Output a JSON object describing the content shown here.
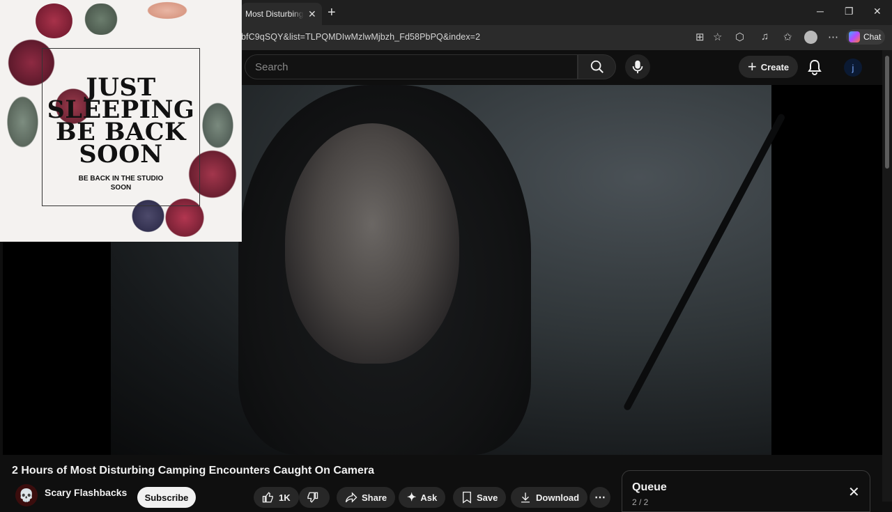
{
  "browser": {
    "tab_title": "Most Disturbing C",
    "url": "bfC9qSQY&list=TLPQMDIwMzlwMjbzh_Fd58PbPQ&index=2",
    "chat_label": "Chat"
  },
  "header": {
    "search_placeholder": "Search",
    "create_label": "Create",
    "avatar_letter": "j"
  },
  "pip": {
    "headline_lines": [
      "JUST",
      "SLEEPING",
      "BE BACK",
      "SOON"
    ],
    "subtext_lines": [
      "BE BACK IN THE STUDIO",
      "SOON"
    ]
  },
  "video": {
    "title": "2 Hours of Most Disturbing Camping Encounters Caught On Camera",
    "channel_name": "Scary Flashbacks",
    "subscribe_label": "Subscribe",
    "like_count": "1K",
    "share_label": "Share",
    "ask_label": "Ask",
    "save_label": "Save",
    "download_label": "Download"
  },
  "queue": {
    "title": "Queue",
    "count": "2 / 2"
  }
}
